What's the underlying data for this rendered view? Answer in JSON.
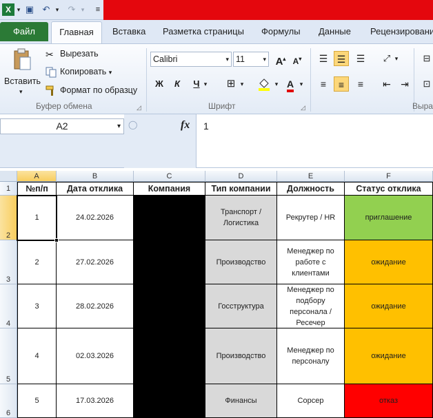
{
  "quick_access": {
    "title_bar_color": "#e4070d"
  },
  "tabs": {
    "file": "Файл",
    "items": [
      "Главная",
      "Вставка",
      "Разметка страницы",
      "Формулы",
      "Данные",
      "Рецензировани"
    ]
  },
  "clipboard": {
    "paste_label": "Вставить",
    "cut_label": "Вырезать",
    "copy_label": "Копировать",
    "format_painter_label": "Формат по образцу",
    "group_label": "Буфер обмена"
  },
  "font": {
    "name": "Calibri",
    "size": "11",
    "group_label": "Шрифт",
    "bold": "Ж",
    "italic": "К",
    "underline": "Ч"
  },
  "alignment": {
    "group_label": "Выра"
  },
  "formula_bar": {
    "name_box": "A2",
    "fx": "fx",
    "value": "1"
  },
  "columns": [
    "A",
    "B",
    "C",
    "D",
    "E",
    "F"
  ],
  "rows": [
    "1",
    "2",
    "3",
    "4",
    "5",
    "6"
  ],
  "table": {
    "headers": [
      "№п/п",
      "Дата отклика",
      "Компания",
      "Тип компании",
      "Должность",
      "Статус отклика"
    ],
    "records": [
      {
        "num": "1",
        "date": "24.02.2026",
        "company": "",
        "type": "Транспорт / Логистика",
        "position": "Рекрутер / HR",
        "status": "приглашение",
        "status_color": "#92d050"
      },
      {
        "num": "2",
        "date": "27.02.2026",
        "company": "",
        "type": "Производство",
        "position": "Менеджер по работе с клиентами",
        "status": "ожидание",
        "status_color": "#ffc000"
      },
      {
        "num": "3",
        "date": "28.02.2026",
        "company": "",
        "type": "Госструктура",
        "position": "Менеджер по подбору персонала / Ресечер",
        "status": "ожидание",
        "status_color": "#ffc000"
      },
      {
        "num": "4",
        "date": "02.03.2026",
        "company": "",
        "type": "Производство",
        "position": "Менеджер по персоналу",
        "status": "ожидание",
        "status_color": "#ffc000"
      },
      {
        "num": "5",
        "date": "17.03.2026",
        "company": "",
        "type": "Финансы",
        "position": "Сорсер",
        "status": "отказ",
        "status_color": "#ff0000"
      }
    ]
  }
}
